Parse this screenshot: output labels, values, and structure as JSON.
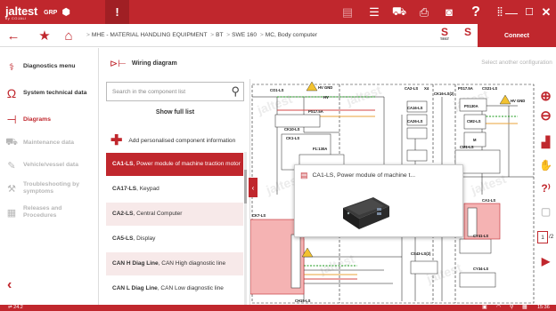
{
  "app": {
    "logo": "jaltest",
    "logo_sub": "by COJALI",
    "brand": "GRP"
  },
  "topbar": {
    "alert": "!",
    "icons": [
      "document-icon",
      "list-icon",
      "vehicle-data-icon",
      "printer-icon",
      "camera-icon",
      "help-icon",
      "apps-grid-icon"
    ],
    "window": [
      "minimize",
      "maximize",
      "close"
    ]
  },
  "breadcrumb": {
    "items": [
      "MHE - MATERIAL HANDLING EQUIPMENT",
      "BT",
      "SWE 160",
      "MC, Body computer"
    ]
  },
  "connect_label": "Connect",
  "select_config": "Select another configuration",
  "menu": {
    "items": [
      {
        "label": "Diagnostics menu",
        "icon": "diagnostics-icon",
        "state": "normal"
      },
      {
        "label": "System technical data",
        "icon": "ohm-icon",
        "state": "normal"
      },
      {
        "label": "Diagrams",
        "icon": "diagram-icon",
        "state": "active"
      },
      {
        "label": "Maintenance data",
        "icon": "maintenance-icon",
        "state": "disabled"
      },
      {
        "label": "Vehicle/vessel data",
        "icon": "wrench-icon",
        "state": "disabled"
      },
      {
        "label": "Troubleshooting by symptoms",
        "icon": "troubleshooting-icon",
        "state": "disabled"
      },
      {
        "label": "Releases and Procedures",
        "icon": "procedures-icon",
        "state": "disabled"
      }
    ]
  },
  "section_title": "Wiring diagram",
  "component_list": {
    "search_placeholder": "Search in the component list",
    "full_list": "Show full list",
    "add_label": "Add personalised component information",
    "rows": [
      {
        "code": "CA1-LS",
        "desc": ", Power module of machine traction motor"
      },
      {
        "code": "CA17-LS",
        "desc": ", Keypad"
      },
      {
        "code": "CA2-LS",
        "desc": ", Central Computer"
      },
      {
        "code": "CA5-LS",
        "desc": ", Display"
      },
      {
        "code": "CAN H Diag Line",
        "desc": ", CAN High diagnostic line"
      },
      {
        "code": "CAN L Diag Line",
        "desc": ", CAN Low diagnostic line"
      }
    ]
  },
  "popup": {
    "title": "CA1-LS, Power module of machine t..."
  },
  "diagram": {
    "watermark": "jaltest",
    "labels": [
      "CO1-LS",
      "HV GND",
      "HV",
      "PS17.5A",
      "CK10-LS",
      "CA2-LS",
      "X4",
      "CK16-LS(2)",
      "PS17.5A",
      "CS21-LS",
      "PS130A",
      "CA16-LS",
      "CA26-LS",
      "CM2-LS",
      "HV GND",
      "M",
      "F1:130A",
      "CK1-LS",
      "CM1-LS",
      "CA1-LS",
      "CK7-LS",
      "CS43-LS(2)",
      "CY41-LS",
      "CY34-LS",
      "CH15-LS"
    ]
  },
  "righttools": {
    "page_current": "1",
    "page_total": "/2"
  },
  "status": {
    "version": "24.2",
    "time": "15:36"
  },
  "colors": {
    "brand_red": "#c0272d",
    "highlight_pink": "#f5b3b3"
  }
}
